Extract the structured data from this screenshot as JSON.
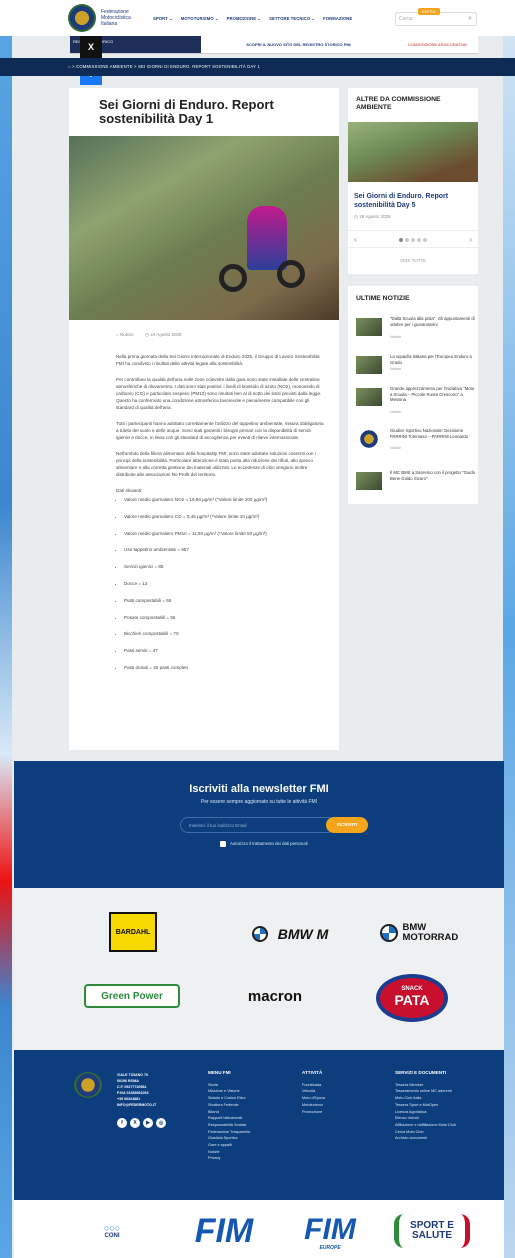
{
  "header": {
    "logo_text": "Federazione Motociclistica Italiana",
    "nav": [
      "SPORT ⌄",
      "MOTOTURISMO ⌄",
      "PROMOZIONE ⌄",
      "SETTORE TECNICO ⌄",
      "FORMAZIONE"
    ],
    "search_placeholder": "Cerca",
    "entra_label": "ENTRA"
  },
  "banner": {
    "left": "REGISTRO STORICO",
    "middle": "SCOPRI IL NUOVO SITO DEL REGISTRO STORICO FMI",
    "right": "CONVENZIONE ASSICURATIVA"
  },
  "social": {
    "x": "X",
    "facebook": "f",
    "email": "✉"
  },
  "breadcrumb": "⌂ > COMMISSIONE AMBIENTE > SEI GIORNI DI ENDURO. REPORT SOSTENIBILITÀ DAY 1",
  "article": {
    "title": "Sei Giorni di Enduro. Report sostenibilità Day 1",
    "category": "Notizie",
    "date": "24 Agosto 2025",
    "paragraphs": [
      "Nella prima giornata della Sei Giorni Internazionale di Enduro 2025, il Gruppo di Lavoro Sostenibilità FMI ha condiviso i risultati delle attività legate alla sostenibilità.",
      "Per controllare la qualità dell'aria nelle zone coinvolte dalla gara sono state installate delle centraline atmosferiche di rilevamento. I dati sono stati positivi: i livelli di biossido di azoto (NO2), monossido di carbonio (CO) e particolato sospeso (PM10) sono risultati ben al di sotto dei limiti previsti dalla legge. Questo ha confermato una condizione atmosferica favorevole e pienamente compatibile con gli standard di qualità dell'aria.",
      "Tutti i partecipanti hanno adottato correttamente l'utilizzo del tappetino ambientale, misura obbligatoria a tutela del suolo e delle acque. Sono stati garantiti i bisogni primari con la disponibilità di servizi igienici e docce, in linea con gli standard di accoglienza per eventi di rilievo internazionale.",
      "Nell'ambito della filiera alimentare della hospitality FMI, sono state adottate soluzioni coerenti con i principi della sostenibilità. Particolare attenzione è stata posta alla riduzione dei rifiuti, allo spreco alimentare e alla corretta gestione dei materiali utilizzati. Le eccedenze di cibo vengono inoltre distribuite alle associazioni No Profit del territorio."
    ],
    "list_heading": "Dati rilevanti:",
    "list": [
      "Valore medio giornaliero NO2 = 19,86 µg/m³ (*Valore limite 200 µg/m³)",
      "Valore medio giornaliero CO = 0,45 µg/m³ (*Valore limite 10 µg/m³)",
      "Valore medio giornaliero PM10 = 11,94 µg/m³ (*Valore limite 50 µg/m³)",
      "Uso tappetino ambientale = 657",
      "Servizi igienici = 85",
      "Docce = 12",
      "Piatti compostabili = 55",
      "Posate compostabili = 55",
      "Bicchieri compostabili = 70",
      "Pasti serviti = 47",
      "Pasti donati = 40 pasti completi"
    ]
  },
  "sidebar_related": {
    "title": "ALTRE DA COMMISSIONE AMBIENTE",
    "card_title": "Sei Giorni di Enduro. Report sostenibilità Day 5",
    "card_date": "28 Agosto 2025",
    "prev": "‹",
    "next": "›",
    "vedi_tutte": "VEDI TUTTE"
  },
  "sidebar_news": {
    "title": "ULTIME NOTIZIE",
    "items": [
      {
        "title": "\"Dalla Scuola alla pista\". Gli appuntamenti di ottobre per i giovanissimi",
        "cat": "Notizie"
      },
      {
        "title": "La squadra Italiana per l'Europeo Enduro a Grado",
        "cat": "Notizie"
      },
      {
        "title": "Grande apprezzamento per l'iniziativa \"Moto a Scuola – Piccole Ruote Crescono\" a Messina",
        "cat": "Notizie"
      },
      {
        "title": "Giudice Sportivo Nazionale: Decisione PARRINI Tommaso – PARRINI Leonardo",
        "cat": "Notizie"
      },
      {
        "title": "Il MC BMS a Sanremo con il progetto \"Guido Bene Guido Sicuro\"",
        "cat": "Notizie"
      }
    ]
  },
  "newsletter": {
    "title": "Iscriviti alla newsletter FMI",
    "subtitle": "Per essere sempre aggiornato su tutte le attività FMI",
    "placeholder": "Inserisci il tuo indirizzo Email",
    "button": "ISCRIVITI",
    "consent": "Autorizzo il trattamento dei dati personali"
  },
  "sponsors": {
    "bardahl": "BARDAHL",
    "bmw_m": "BMW M",
    "bmw_motorrad": "BMW MOTORRAD",
    "greenpower": "Green Power",
    "macron": "macron",
    "pata": "PATA",
    "pata_snack": "SNACK"
  },
  "footer": {
    "address": [
      "VIALE TIZIANO 70",
      "00196 ROMA",
      "C.F. 05277720584",
      "P.IVA 01383961003",
      "+39 06324881",
      "INFO@FEDERMOTO.IT"
    ],
    "social_icons": [
      "f",
      "X",
      "▶",
      "◎"
    ],
    "col1": {
      "heading": "MENU FMI",
      "items": [
        "Storia",
        "Missione e Visione",
        "Statuto e Codice Etico",
        "Struttura Federale",
        "Bilanci",
        "Rapporti Istituzionali",
        "Responsabilità Sociale",
        "Federazione Trasparente",
        "Giustizia Sportiva",
        "Gare e appalti",
        "Notizie",
        "Privacy"
      ]
    },
    "col2": {
      "heading": "ATTIVITÀ",
      "items": [
        "Fuoristrada",
        "Velocità",
        "Moto d'Epoca",
        "Mototurismo",
        "Promozione"
      ]
    },
    "col3": {
      "heading": "SERVIZI E DOCUMENTI",
      "items": [
        "Tessera Member",
        "Tesseramento online MC aderenti",
        "Moto Club Italia",
        "Tessera Sport e MotOpen",
        "Licenza Agonistica",
        "Elenco Veicoli",
        "Affiliazione e riaffiliazione Moto Club",
        "Cerca Moto Club",
        "Archivio documenti"
      ]
    }
  },
  "partners": {
    "coni": "CONI",
    "fim": "FIM",
    "fim_europe": "FIM",
    "fim_europe_sub": "EUROPE",
    "sport_salute": "SPORT E SALUTE"
  },
  "colors": {
    "navy": "#0c3e7e",
    "dark_navy": "#0d2b55",
    "accent": "#f4a51c"
  }
}
